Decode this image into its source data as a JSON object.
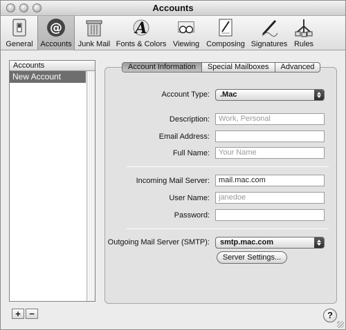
{
  "window": {
    "title": "Accounts"
  },
  "toolbar": {
    "items": [
      {
        "label": "General",
        "icon": "light-switch-icon"
      },
      {
        "label": "Accounts",
        "icon": "at-sign-icon"
      },
      {
        "label": "Junk Mail",
        "icon": "trash-can-icon"
      },
      {
        "label": "Fonts & Colors",
        "icon": "font-icon"
      },
      {
        "label": "Viewing",
        "icon": "glasses-icon"
      },
      {
        "label": "Composing",
        "icon": "pencil-paper-icon"
      },
      {
        "label": "Signatures",
        "icon": "pen-icon"
      },
      {
        "label": "Rules",
        "icon": "rules-icon"
      }
    ],
    "selected": "Accounts"
  },
  "accounts": {
    "header": "Accounts",
    "items": [
      "New Account"
    ],
    "add_label": "+",
    "remove_label": "−"
  },
  "tabs": {
    "items": [
      "Account Information",
      "Special Mailboxes",
      "Advanced"
    ],
    "active": "Account Information"
  },
  "form": {
    "account_type_label": "Account Type:",
    "account_type_value": ".Mac",
    "description_label": "Description:",
    "description_placeholder": "Work, Personal",
    "email_label": "Email Address:",
    "email_value": "",
    "fullname_label": "Full Name:",
    "fullname_placeholder": "Your Name",
    "incoming_label": "Incoming Mail Server:",
    "incoming_value": "mail.mac.com",
    "username_label": "User Name:",
    "username_placeholder": "janedoe",
    "password_label": "Password:",
    "password_value": "",
    "outgoing_label": "Outgoing Mail Server (SMTP):",
    "outgoing_value": "smtp.mac.com",
    "server_settings_label": "Server Settings..."
  },
  "help": {
    "label": "?"
  }
}
